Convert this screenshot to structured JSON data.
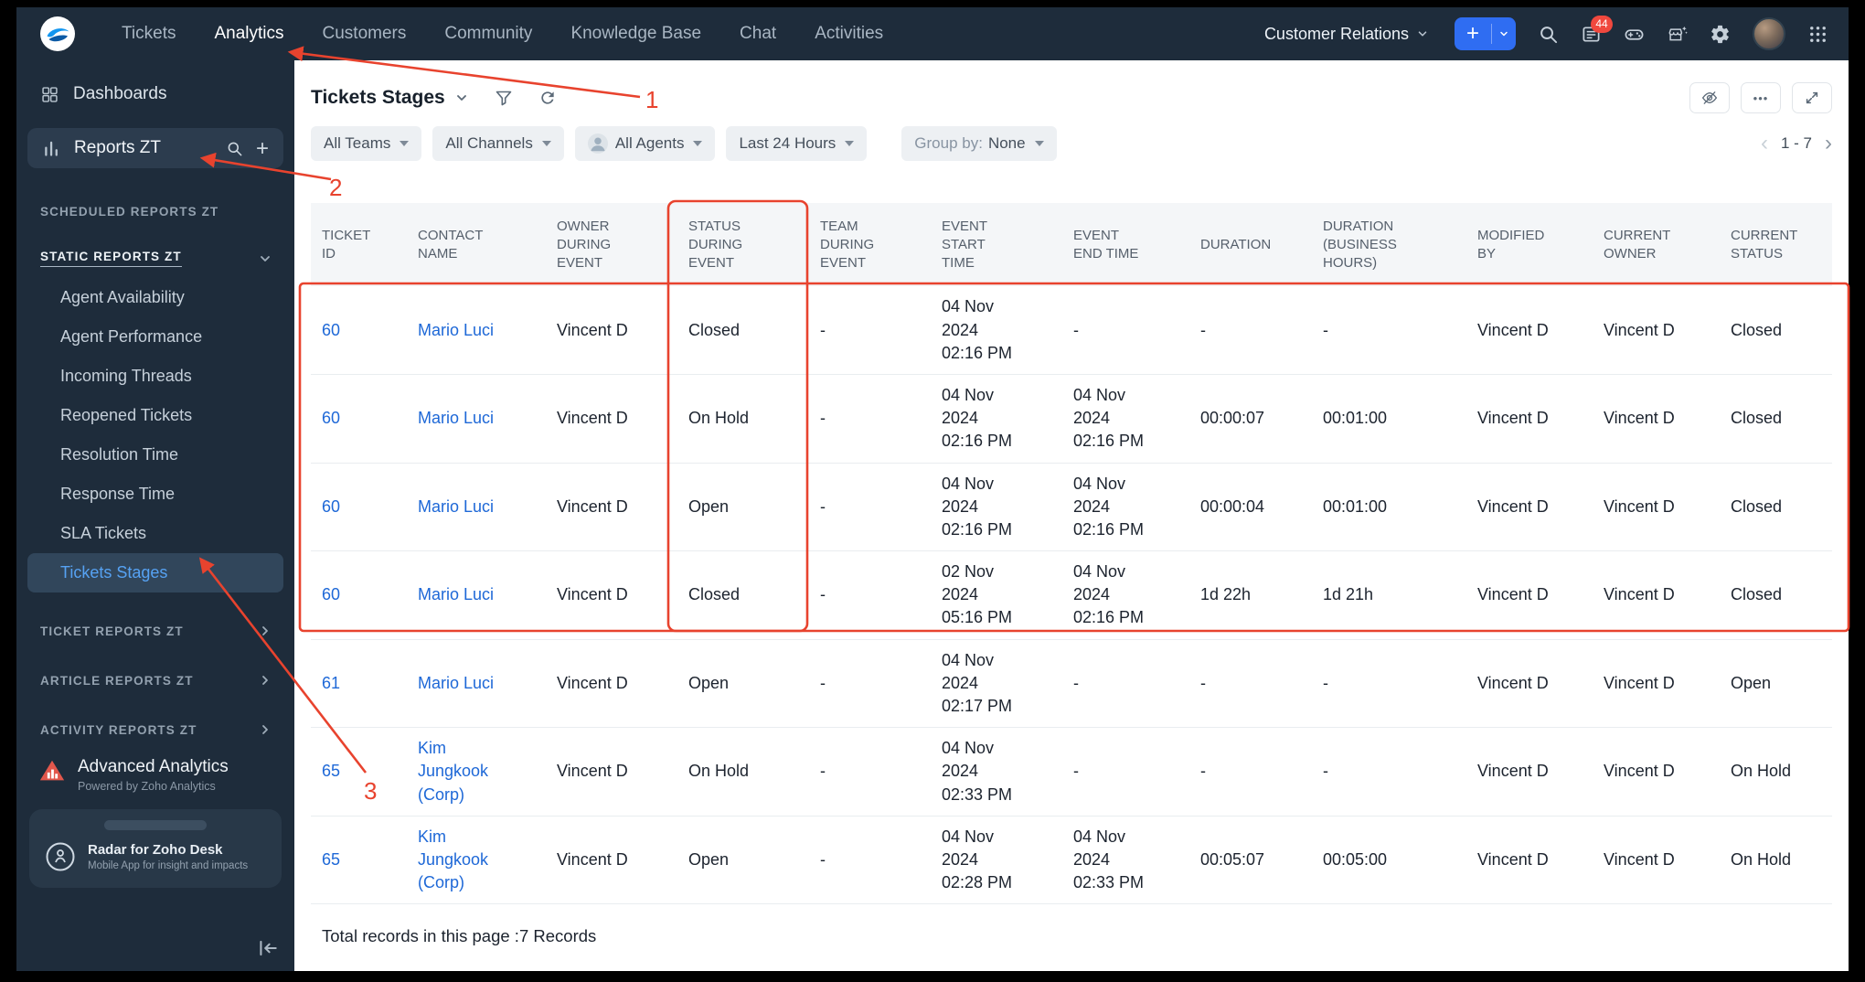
{
  "topnav": {
    "items": [
      {
        "label": "Tickets",
        "active": false
      },
      {
        "label": "Analytics",
        "active": true
      },
      {
        "label": "Customers",
        "active": false
      },
      {
        "label": "Community",
        "active": false
      },
      {
        "label": "Knowledge Base",
        "active": false
      },
      {
        "label": "Chat",
        "active": false
      },
      {
        "label": "Activities",
        "active": false
      }
    ],
    "org_selector": "Customer Relations",
    "notification_badge": "44"
  },
  "sidebar": {
    "dashboards_label": "Dashboards",
    "reports_label": "Reports ZT",
    "scheduled_header": "SCHEDULED REPORTS ZT",
    "static_header": "STATIC REPORTS ZT",
    "static_items": [
      {
        "label": "Agent Availability",
        "selected": false
      },
      {
        "label": "Agent Performance",
        "selected": false
      },
      {
        "label": "Incoming Threads",
        "selected": false
      },
      {
        "label": "Reopened Tickets",
        "selected": false
      },
      {
        "label": "Resolution Time",
        "selected": false
      },
      {
        "label": "Response Time",
        "selected": false
      },
      {
        "label": "SLA Tickets",
        "selected": false
      },
      {
        "label": "Tickets Stages",
        "selected": true
      }
    ],
    "ticket_header": "TICKET REPORTS ZT",
    "article_header": "ARTICLE REPORTS ZT",
    "activity_header": "ACTIVITY REPORTS ZT",
    "advanced_analytics_title": "Advanced Analytics",
    "advanced_analytics_subtitle": "Powered by Zoho Analytics",
    "radar_title": "Radar for Zoho Desk",
    "radar_subtitle": "Mobile App for insight and impacts"
  },
  "main": {
    "title": "Tickets Stages",
    "filters": [
      {
        "label": "All Teams"
      },
      {
        "label": "All Channels"
      },
      {
        "label": "All Agents",
        "icon": "agent-avatar"
      },
      {
        "label": "Last 24 Hours"
      }
    ],
    "group_by_label": "Group by:",
    "group_by_value": "None",
    "pagination": "1 - 7",
    "footer_text": "Total records in this page :7 Records"
  },
  "table": {
    "columns": [
      "TICKET\nID",
      "CONTACT\nNAME",
      "OWNER\nDURING\nEVENT",
      "STATUS\nDURING\nEVENT",
      "TEAM\nDURING\nEVENT",
      "EVENT\nSTART\nTIME",
      "EVENT\nEND TIME",
      "DURATION",
      "DURATION\n(BUSINESS\nHOURS)",
      "MODIFIED\nBY",
      "CURRENT\nOWNER",
      "CURRENT\nSTATUS"
    ],
    "rows": [
      {
        "ticket_id": "60",
        "contact": "Mario Luci",
        "owner": "Vincent D",
        "status": "Closed",
        "team": "-",
        "start": "04 Nov\n2024\n02:16 PM",
        "end": "-",
        "duration": "-",
        "duration_bh": "-",
        "modified_by": "Vincent D",
        "current_owner": "Vincent D",
        "current_status": "Closed"
      },
      {
        "ticket_id": "60",
        "contact": "Mario Luci",
        "owner": "Vincent D",
        "status": "On Hold",
        "team": "-",
        "start": "04 Nov\n2024\n02:16 PM",
        "end": "04 Nov\n2024\n02:16 PM",
        "duration": "00:00:07",
        "duration_bh": "00:01:00",
        "modified_by": "Vincent D",
        "current_owner": "Vincent D",
        "current_status": "Closed"
      },
      {
        "ticket_id": "60",
        "contact": "Mario Luci",
        "owner": "Vincent D",
        "status": "Open",
        "team": "-",
        "start": "04 Nov\n2024\n02:16 PM",
        "end": "04 Nov\n2024\n02:16 PM",
        "duration": "00:00:04",
        "duration_bh": "00:01:00",
        "modified_by": "Vincent D",
        "current_owner": "Vincent D",
        "current_status": "Closed"
      },
      {
        "ticket_id": "60",
        "contact": "Mario Luci",
        "owner": "Vincent D",
        "status": "Closed",
        "team": "-",
        "start": "02 Nov\n2024\n05:16 PM",
        "end": "04 Nov\n2024\n02:16 PM",
        "duration": "1d 22h",
        "duration_bh": "1d 21h",
        "modified_by": "Vincent D",
        "current_owner": "Vincent D",
        "current_status": "Closed"
      },
      {
        "ticket_id": "61",
        "contact": "Mario Luci",
        "owner": "Vincent D",
        "status": "Open",
        "team": "-",
        "start": "04 Nov\n2024\n02:17 PM",
        "end": "-",
        "duration": "-",
        "duration_bh": "-",
        "modified_by": "Vincent D",
        "current_owner": "Vincent D",
        "current_status": "Open"
      },
      {
        "ticket_id": "65",
        "contact": "Kim\nJungkook\n(Corp)",
        "owner": "Vincent D",
        "status": "On Hold",
        "team": "-",
        "start": "04 Nov\n2024\n02:33 PM",
        "end": "-",
        "duration": "-",
        "duration_bh": "-",
        "modified_by": "Vincent D",
        "current_owner": "Vincent D",
        "current_status": "On Hold"
      },
      {
        "ticket_id": "65",
        "contact": "Kim\nJungkook\n(Corp)",
        "owner": "Vincent D",
        "status": "Open",
        "team": "-",
        "start": "04 Nov\n2024\n02:28 PM",
        "end": "04 Nov\n2024\n02:33 PM",
        "duration": "00:05:07",
        "duration_bh": "00:05:00",
        "modified_by": "Vincent D",
        "current_owner": "Vincent D",
        "current_status": "On Hold"
      }
    ]
  },
  "icons": {
    "plus": "+",
    "ellipsis": "•••",
    "pagination_prev": "‹",
    "pagination_next": "›"
  },
  "annotations": {
    "step1": "1",
    "step2": "2",
    "step3": "3"
  },
  "colors": {
    "accent_blue": "#2f6df2",
    "link_blue": "#1e68d7",
    "annotation_red": "#e8432e",
    "nav_dark": "#1e2c3b"
  }
}
